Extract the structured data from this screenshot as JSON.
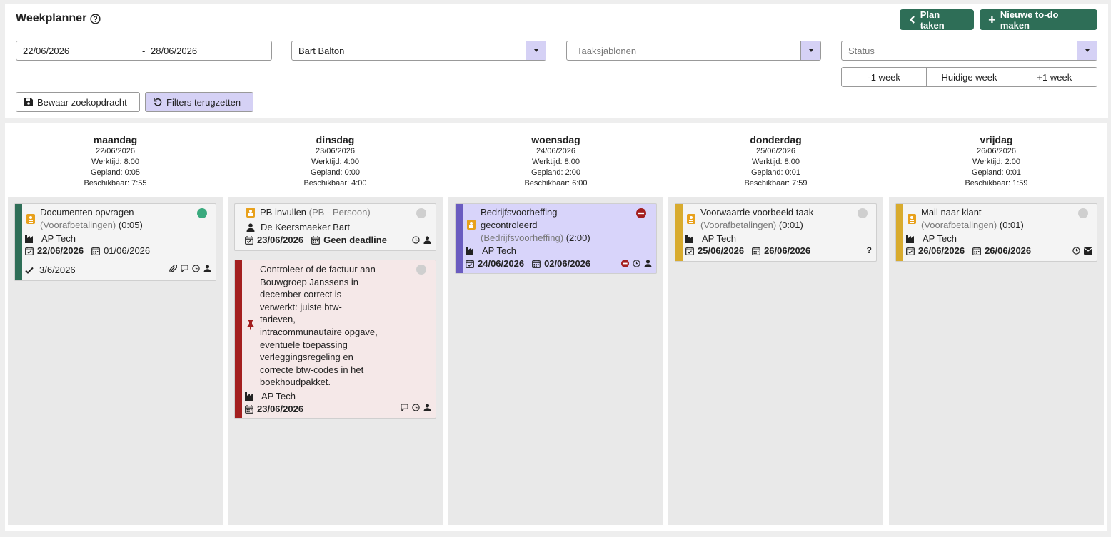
{
  "header": {
    "title": "Weekplanner",
    "plan_label": "Plan taken",
    "new_todo_label": "Nieuwe to-do maken"
  },
  "filters": {
    "date_from": "22/06/2026",
    "date_sep": "-",
    "date_to": "28/06/2026",
    "user": "Bart Balton",
    "templates_placeholder": "Taaksjablonen",
    "status_placeholder": "Status",
    "prev_week": "-1 week",
    "this_week": "Huidige week",
    "next_week": "+1 week",
    "save_search": "Bewaar zoekopdracht",
    "reset_filters": "Filters terugzetten"
  },
  "colors": {
    "accent_green": "#2e6e57",
    "accent_purple": "#d5d1f5",
    "bar_green": "#2e6e57",
    "bar_red": "#a31f1f",
    "bar_purple": "#6a5cc0",
    "bar_yellow": "#d8ab2e",
    "card_red_bg": "#f5e8e8",
    "card_purple_bg": "#d8d4fa"
  },
  "days": [
    {
      "name": "maandag",
      "date": "22/06/2026",
      "worktime": "Werktijd: 8:00",
      "planned": "Gepland: 0:05",
      "available": "Beschikbaar: 7:55"
    },
    {
      "name": "dinsdag",
      "date": "23/06/2026",
      "worktime": "Werktijd: 4:00",
      "planned": "Gepland: 0:00",
      "available": "Beschikbaar: 4:00"
    },
    {
      "name": "woensdag",
      "date": "24/06/2026",
      "worktime": "Werktijd: 8:00",
      "planned": "Gepland: 2:00",
      "available": "Beschikbaar: 6:00"
    },
    {
      "name": "donderdag",
      "date": "25/06/2026",
      "worktime": "Werktijd: 8:00",
      "planned": "Gepland: 0:01",
      "available": "Beschikbaar: 7:59"
    },
    {
      "name": "vrijdag",
      "date": "26/06/2026",
      "worktime": "Werktijd: 2:00",
      "planned": "Gepland: 0:01",
      "available": "Beschikbaar: 1:59"
    }
  ],
  "cards": {
    "mon1": {
      "title": "Documenten opvragen",
      "template": "(Voorafbetalingen)",
      "duration": "(0:05)",
      "client": "AP Tech",
      "date": "22/06/2026",
      "deadline": "01/06/2026",
      "completed": "3/6/2026",
      "status_color": "#3aaa7e"
    },
    "tue1": {
      "title": "PB invullen",
      "template": "(PB - Persoon)",
      "person": "De Keersmaeker Bart",
      "date": "23/06/2026",
      "deadline": "Geen deadline"
    },
    "tue2": {
      "lines": [
        "Controleer of de factuur aan",
        "Bouwgroep Janssens in",
        "december correct is",
        "verwerkt: juiste btw-",
        "tarieven,",
        "intracommunautaire opgave,",
        "eventuele toepassing",
        "verleggingsregeling en",
        "correcte btw-codes in het",
        "boekhoudpakket."
      ],
      "client": "AP Tech",
      "date": "23/06/2026"
    },
    "wed1": {
      "title1": "Bedrijfsvoorheffing",
      "title2": "gecontroleerd",
      "template": "(Bedrijfsvoorheffing)",
      "duration": "(2:00)",
      "client": "AP Tech",
      "date": "24/06/2026",
      "deadline": "02/06/2026"
    },
    "thu1": {
      "title": "Voorwaarde voorbeeld taak",
      "template": "(Voorafbetalingen)",
      "duration": "(0:01)",
      "client": "AP Tech",
      "date": "25/06/2026",
      "deadline": "26/06/2026",
      "unknown": "?"
    },
    "fri1": {
      "title": "Mail naar klant",
      "template": "(Voorafbetalingen)",
      "duration": "(0:01)",
      "client": "AP Tech",
      "date": "26/06/2026",
      "deadline": "26/06/2026"
    }
  }
}
